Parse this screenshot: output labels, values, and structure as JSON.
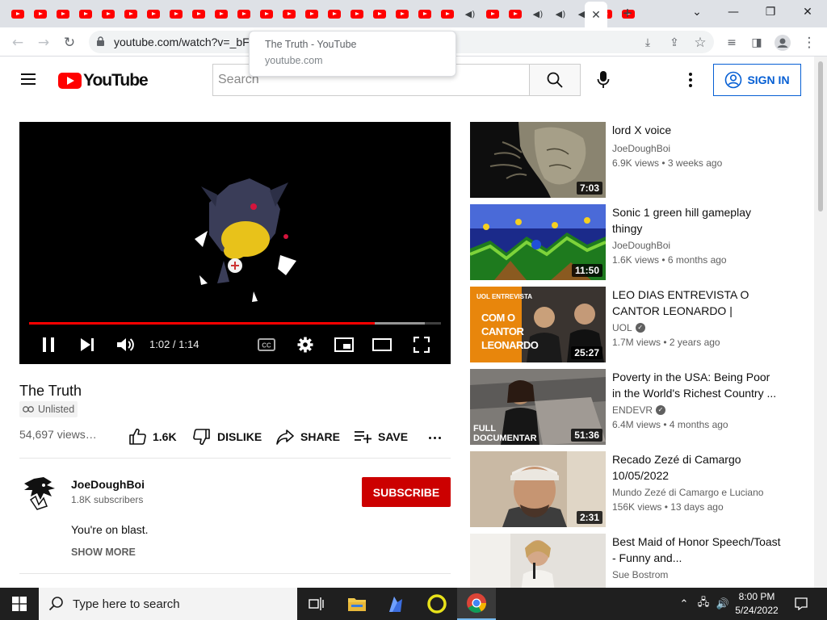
{
  "browser": {
    "tab_count_youtube": 28,
    "url": "youtube.com/watch?v=_bF4f5_m5EQ",
    "tooltip": {
      "title": "The Truth - YouTube",
      "url": "youtube.com"
    },
    "window_controls": {
      "dropdown": "⌄",
      "minimize": "—",
      "restore": "❐",
      "close": "✕"
    }
  },
  "youtube": {
    "logo_text": "YouTube",
    "search_placeholder": "Search",
    "signin_label": "SIGN IN",
    "brand_red": "#ff0000",
    "link_blue": "#065fd4"
  },
  "player": {
    "time_display": "1:02 / 1:14",
    "progress_played_fraction": 0.84,
    "progress_loaded_fraction": 0.96
  },
  "video": {
    "title": "The Truth",
    "badge": "Unlisted",
    "views": "54,697 views…",
    "likes": "1.6K",
    "dislike_label": "DISLIKE",
    "share_label": "SHARE",
    "save_label": "SAVE"
  },
  "channel": {
    "name": "JoeDoughBoi",
    "subscribers": "1.8K subscribers",
    "subscribe_label": "SUBSCRIBE",
    "description": "You're on blast.",
    "show_more": "SHOW MORE"
  },
  "recommendations": [
    {
      "title": "lord X voice",
      "channel": "JoeDoughBoi",
      "verified": false,
      "meta": "6.9K views • 3 weeks ago",
      "duration": "7:03"
    },
    {
      "title": "Sonic 1 green hill gameplay thingy",
      "channel": "JoeDoughBoi",
      "verified": false,
      "meta": "1.6K views • 6 months ago",
      "duration": "11:50"
    },
    {
      "title": "LEO DIAS ENTREVISTA O CANTOR LEONARDO | ÍNTEGRA",
      "channel": "UOL",
      "verified": true,
      "meta": "1.7M views • 2 years ago",
      "duration": "25:27",
      "thumb_text": "COM O CANTOR LEONARDO",
      "thumb_banner": "UOL ENTREVISTA"
    },
    {
      "title": "Poverty in the USA: Being Poor in the World's Richest Country ...",
      "channel": "ENDEVR",
      "verified": true,
      "meta": "6.4M views • 4 months ago",
      "duration": "51:36",
      "thumb_text": "FULL DOCUMENTAR"
    },
    {
      "title": "Recado Zezé di Camargo 10/05/2022",
      "channel": "Mundo Zezé di Camargo e Luciano",
      "verified": false,
      "meta": "156K views • 13 days ago",
      "duration": "2:31"
    },
    {
      "title": "Best Maid of Honor Speech/Toast - Funny and...",
      "channel": "Sue Bostrom",
      "verified": false,
      "meta": "",
      "duration": ""
    }
  ],
  "taskbar": {
    "search_placeholder": "Type here to search",
    "time": "8:00 PM",
    "date": "5/24/2022"
  }
}
